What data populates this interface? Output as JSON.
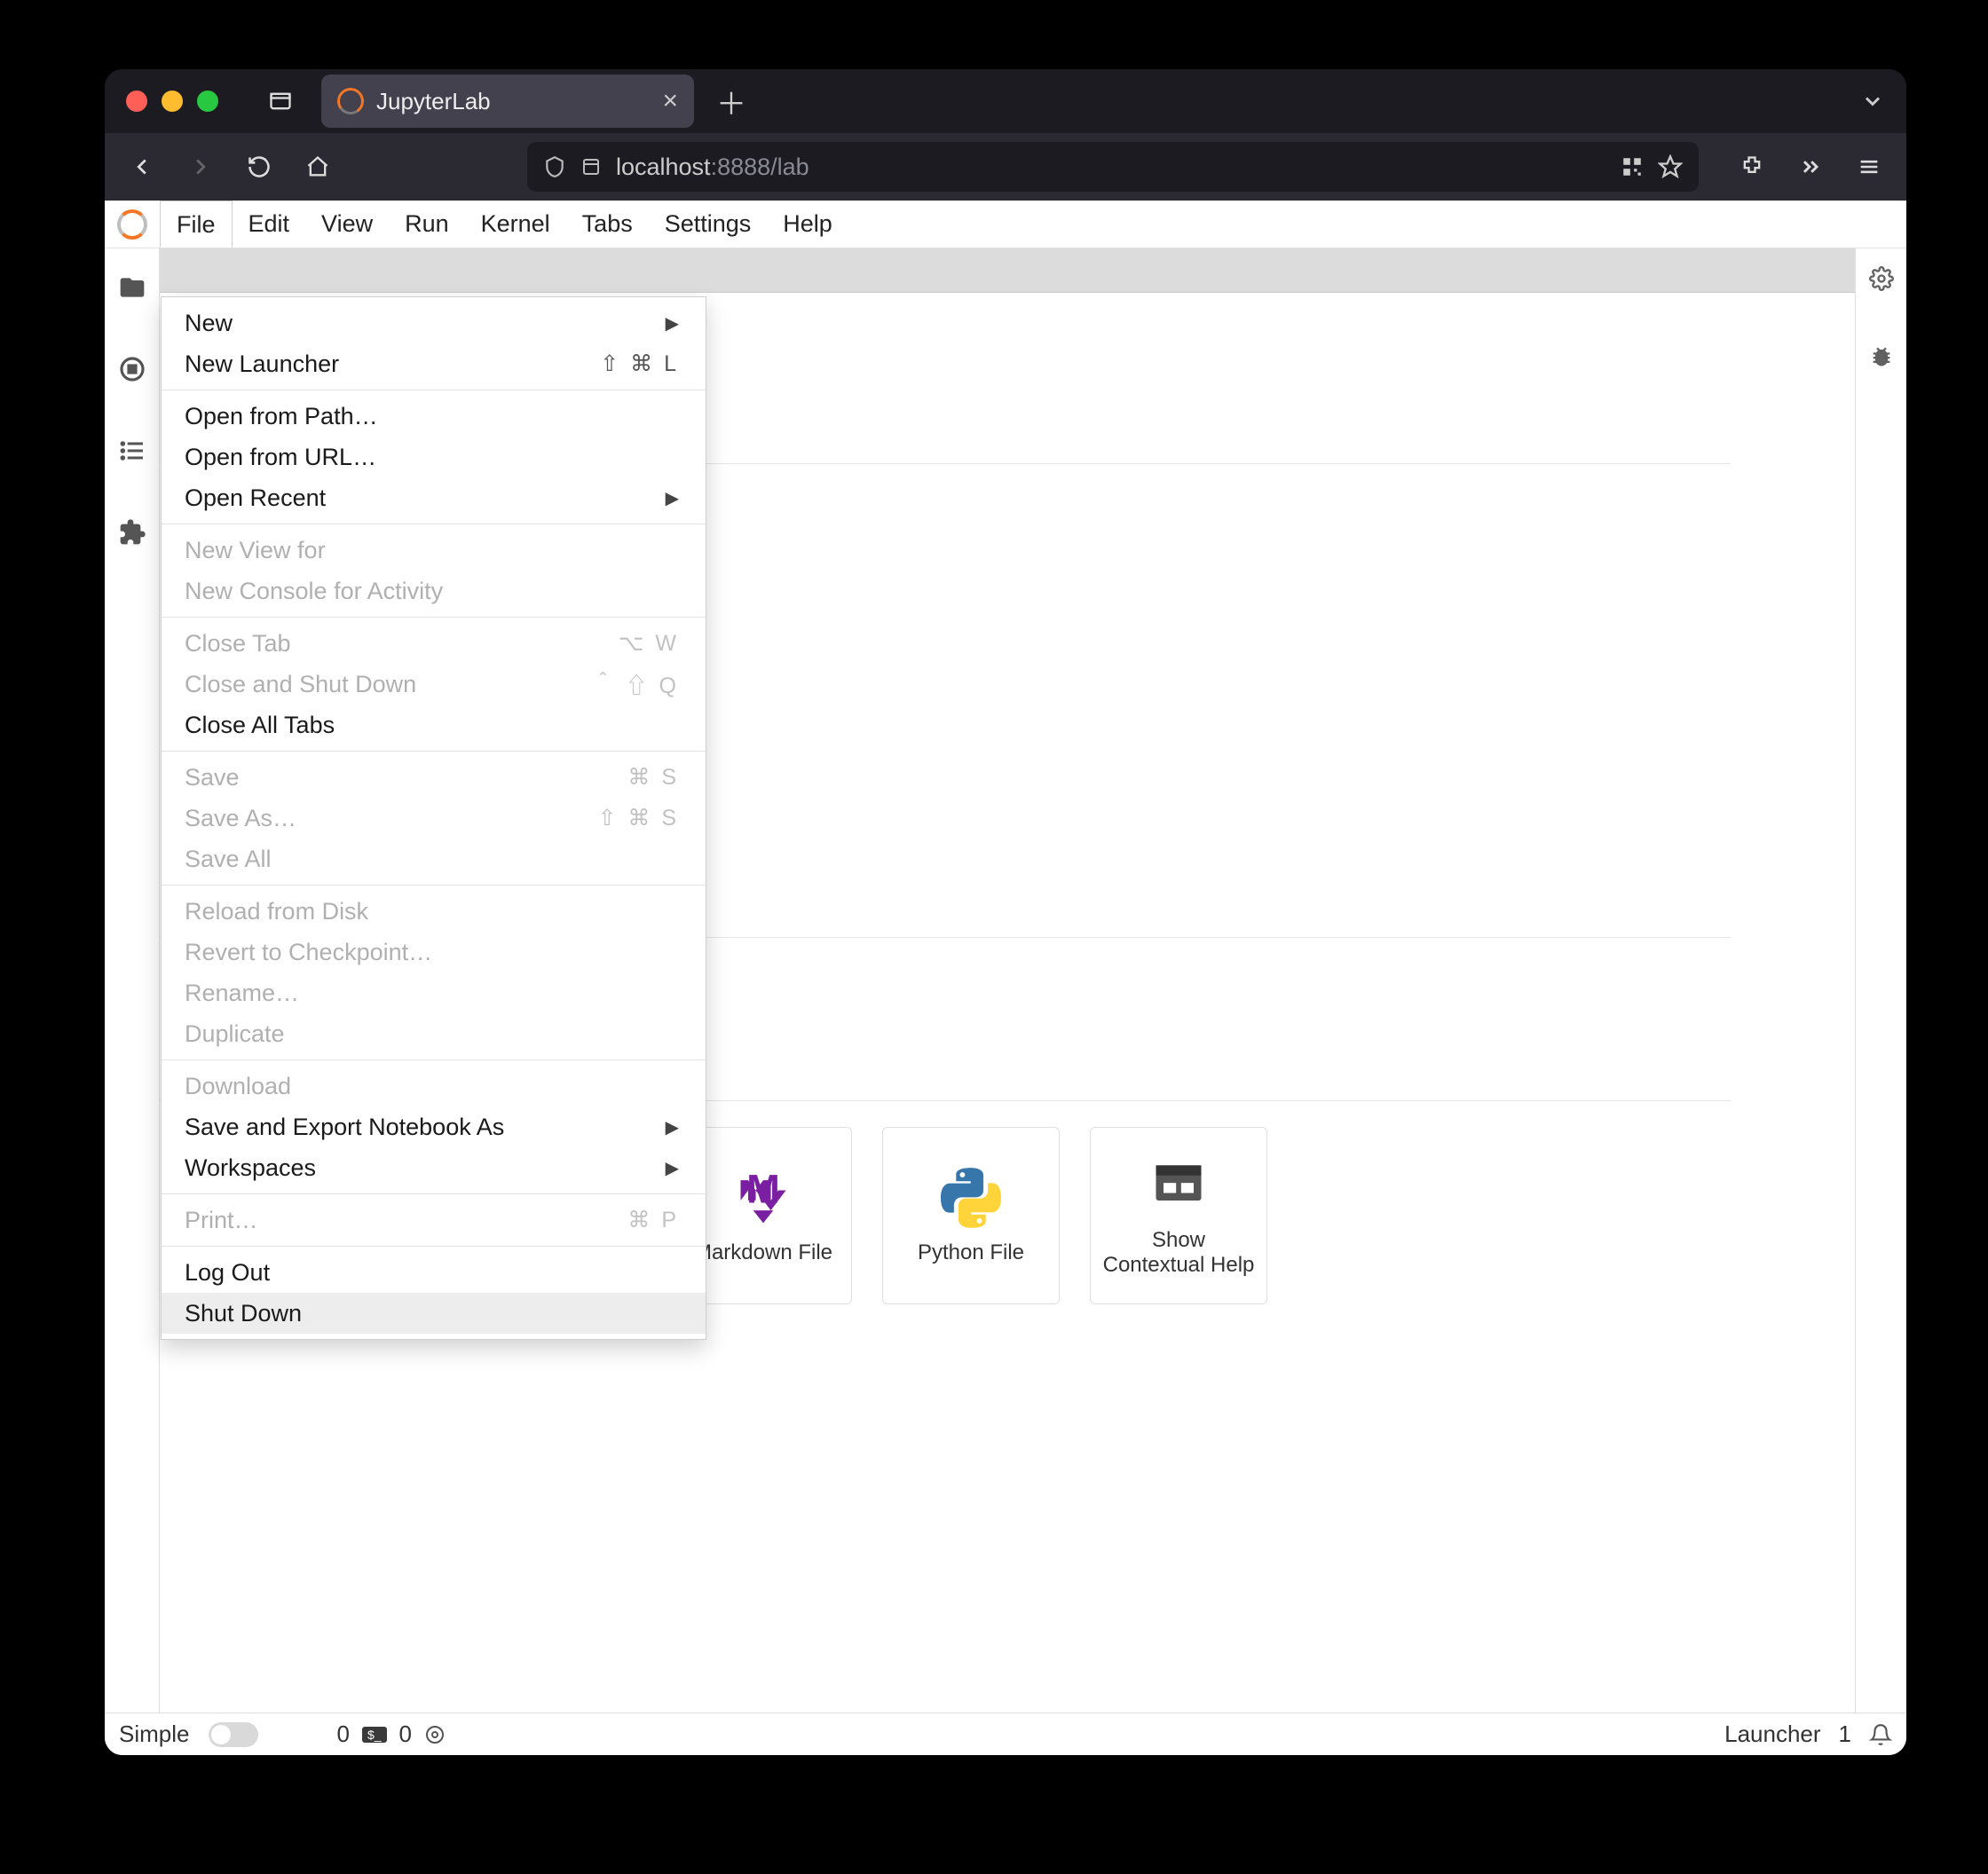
{
  "browser": {
    "tab_title": "JupyterLab",
    "url_host": "localhost",
    "url_rest": ":8888/lab"
  },
  "menubar": {
    "items": [
      "File",
      "Edit",
      "View",
      "Run",
      "Kernel",
      "Tabs",
      "Settings",
      "Help"
    ],
    "open_index": 0
  },
  "file_menu": {
    "groups": [
      [
        {
          "label": "New",
          "submenu": true
        },
        {
          "label": "New Launcher",
          "shortcut": "⇧ ⌘ L"
        }
      ],
      [
        {
          "label": "Open from Path…"
        },
        {
          "label": "Open from URL…"
        },
        {
          "label": "Open Recent",
          "submenu": true
        }
      ],
      [
        {
          "label": "New View for",
          "disabled": true
        },
        {
          "label": "New Console for Activity",
          "disabled": true
        }
      ],
      [
        {
          "label": "Close Tab",
          "shortcut": "⌥ W",
          "disabled": true
        },
        {
          "label": "Close and Shut Down",
          "shortcut": "＾ ⇧ Q",
          "disabled": true
        },
        {
          "label": "Close All Tabs"
        }
      ],
      [
        {
          "label": "Save",
          "shortcut": "⌘ S",
          "disabled": true
        },
        {
          "label": "Save As…",
          "shortcut": "⇧ ⌘ S",
          "disabled": true
        },
        {
          "label": "Save All",
          "disabled": true
        }
      ],
      [
        {
          "label": "Reload from Disk",
          "disabled": true
        },
        {
          "label": "Revert to Checkpoint…",
          "disabled": true
        },
        {
          "label": "Rename…",
          "disabled": true
        },
        {
          "label": "Duplicate",
          "disabled": true
        }
      ],
      [
        {
          "label": "Download",
          "disabled": true
        },
        {
          "label": "Save and Export Notebook As",
          "submenu": true
        },
        {
          "label": "Workspaces",
          "submenu": true
        }
      ],
      [
        {
          "label": "Print…",
          "shortcut": "⌘ P",
          "disabled": true
        }
      ],
      [
        {
          "label": "Log Out"
        },
        {
          "label": "Shut Down",
          "hover": true
        }
      ]
    ]
  },
  "launcher_cards": [
    {
      "label": "Markdown File",
      "icon": "markdown"
    },
    {
      "label": "Python File",
      "icon": "python"
    },
    {
      "label": "Show\nContextual Help",
      "icon": "help"
    }
  ],
  "statusbar": {
    "simple_label": "Simple",
    "kernel_count": "0",
    "terminal_count": "0",
    "mode": "Launcher",
    "line": "1"
  }
}
